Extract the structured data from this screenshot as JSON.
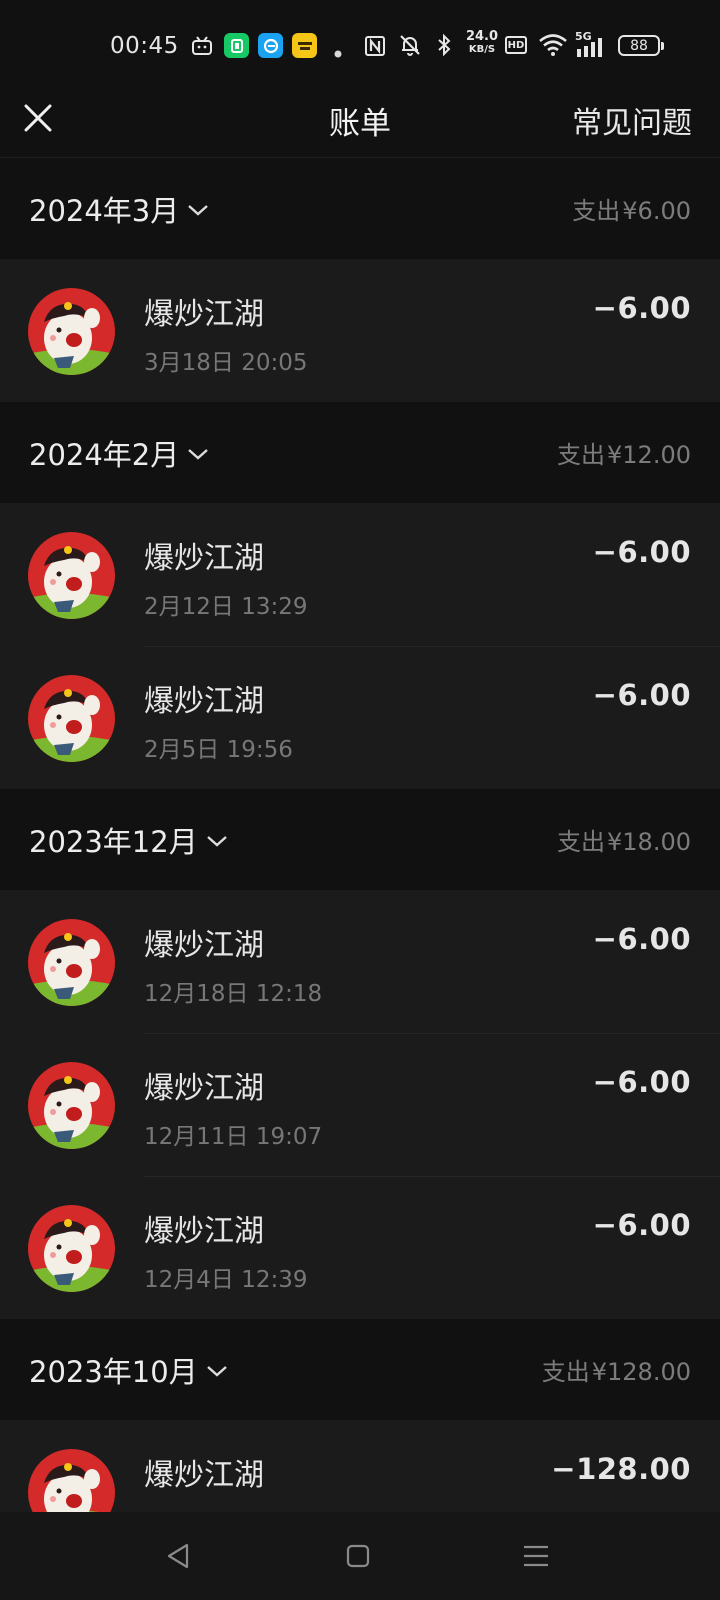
{
  "status_bar": {
    "time": "00:45",
    "net_speed_value": "24.0",
    "net_speed_unit": "KB/S",
    "hd_label": "HD",
    "network_label": "5G",
    "battery_level": "88",
    "icons": [
      "bilibili-icon",
      "green-app-icon",
      "blue-app-icon",
      "yellow-app-icon",
      "dot-icon",
      "nfc-icon",
      "mute-bell-icon",
      "bluetooth-icon",
      "wifi-icon",
      "signal-icon"
    ]
  },
  "header": {
    "title": "账单",
    "faq": "常见问题",
    "close_icon": "close-icon"
  },
  "months": [
    {
      "label": "2024年3月",
      "summary_prefix": "支出",
      "summary_amount": "¥6.00",
      "transactions": [
        {
          "name": "爆炒江湖",
          "time": "3月18日 20:05",
          "amount": "−6.00"
        }
      ]
    },
    {
      "label": "2024年2月",
      "summary_prefix": "支出",
      "summary_amount": "¥12.00",
      "transactions": [
        {
          "name": "爆炒江湖",
          "time": "2月12日 13:29",
          "amount": "−6.00"
        },
        {
          "name": "爆炒江湖",
          "time": "2月5日 19:56",
          "amount": "−6.00"
        }
      ]
    },
    {
      "label": "2023年12月",
      "summary_prefix": "支出",
      "summary_amount": "¥18.00",
      "transactions": [
        {
          "name": "爆炒江湖",
          "time": "12月18日 12:18",
          "amount": "−6.00"
        },
        {
          "name": "爆炒江湖",
          "time": "12月11日 19:07",
          "amount": "−6.00"
        },
        {
          "name": "爆炒江湖",
          "time": "12月4日 12:39",
          "amount": "−6.00"
        }
      ]
    },
    {
      "label": "2023年10月",
      "summary_prefix": "支出",
      "summary_amount": "¥128.00",
      "transactions": [
        {
          "name": "爆炒江湖",
          "time": "",
          "amount": "−128.00"
        }
      ]
    }
  ],
  "nav": {
    "icons": [
      "back-triangle-icon",
      "home-square-icon",
      "menu-lines-icon"
    ]
  },
  "colors": {
    "background": "#111111",
    "row_background": "#1b1b1b",
    "text_primary": "#e6e6e6",
    "text_secondary": "#777777",
    "avatar_red": "#d42a2a",
    "avatar_green": "#7cb82f"
  }
}
